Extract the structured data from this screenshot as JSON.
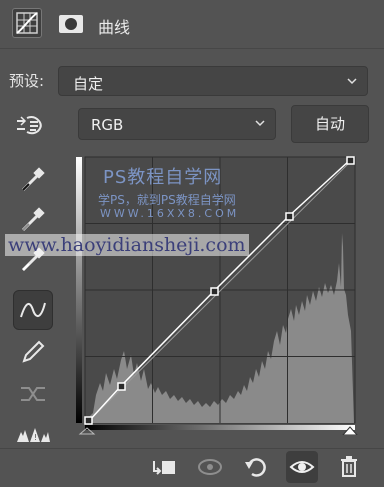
{
  "header": {
    "title": "曲线"
  },
  "preset": {
    "label": "预设:",
    "value": "自定"
  },
  "channel": {
    "value": "RGB"
  },
  "auto_button": {
    "label": "自动"
  },
  "watermark": {
    "line1": "PS教程自学网",
    "line2": "学PS，就到PS教程自学网",
    "line3": "WWW.16XX8.COM",
    "line4": "www.haoyidiansheji.com"
  }
}
